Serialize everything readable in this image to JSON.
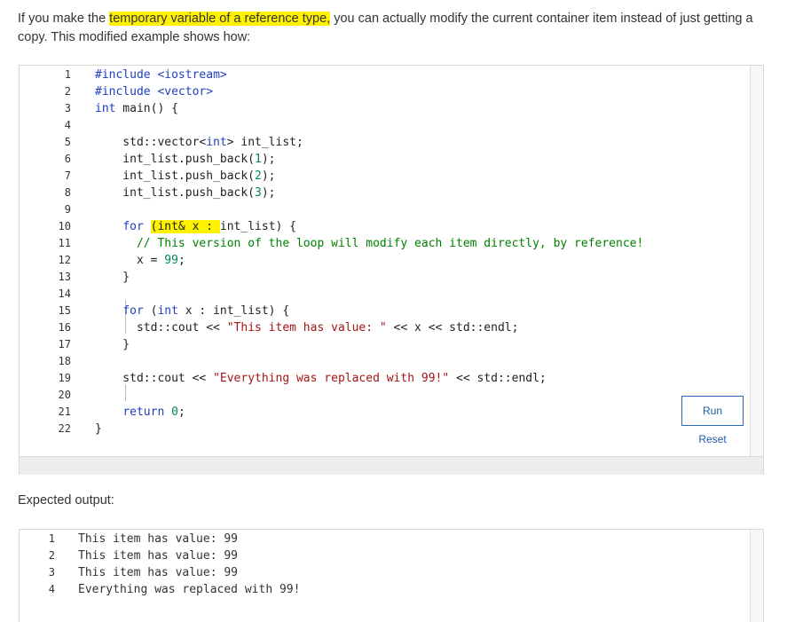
{
  "intro": {
    "before": "If you make the ",
    "highlight": "temporary variable of a reference type,",
    "after": " you can actually modify the current container item instead of just getting a copy. This modified example shows how:"
  },
  "code_lines": [
    {
      "n": "1",
      "parts": [
        [
          "pp",
          "#include "
        ],
        [
          "str2",
          "<iostream>"
        ]
      ]
    },
    {
      "n": "2",
      "parts": [
        [
          "pp",
          "#include "
        ],
        [
          "str2",
          "<vector>"
        ]
      ]
    },
    {
      "n": "3",
      "parts": [
        [
          "kw",
          "int"
        ],
        [
          "t",
          " main() {"
        ]
      ]
    },
    {
      "n": "4",
      "parts": []
    },
    {
      "n": "5",
      "parts": [
        [
          "t",
          "    std::vector<"
        ],
        [
          "kw",
          "int"
        ],
        [
          "t",
          "> int_list;"
        ]
      ]
    },
    {
      "n": "6",
      "parts": [
        [
          "t",
          "    int_list.push_back("
        ],
        [
          "num",
          "1"
        ],
        [
          "t",
          ");"
        ]
      ]
    },
    {
      "n": "7",
      "parts": [
        [
          "t",
          "    int_list.push_back("
        ],
        [
          "num",
          "2"
        ],
        [
          "t",
          ");"
        ]
      ]
    },
    {
      "n": "8",
      "parts": [
        [
          "t",
          "    int_list.push_back("
        ],
        [
          "num",
          "3"
        ],
        [
          "t",
          ");"
        ]
      ]
    },
    {
      "n": "9",
      "parts": []
    },
    {
      "n": "10",
      "parts": [
        [
          "t",
          "    "
        ],
        [
          "kw",
          "for"
        ],
        [
          "t",
          " "
        ],
        [
          "hl",
          "(int& x : "
        ],
        [
          "t",
          "int_list) {"
        ]
      ]
    },
    {
      "n": "11",
      "parts": [
        [
          "t",
          "      "
        ],
        [
          "cm",
          "// This version of the loop will modify each item directly, by reference!"
        ]
      ]
    },
    {
      "n": "12",
      "parts": [
        [
          "t",
          "      x = "
        ],
        [
          "num",
          "99"
        ],
        [
          "t",
          ";"
        ]
      ]
    },
    {
      "n": "13",
      "parts": [
        [
          "t",
          "    }"
        ]
      ]
    },
    {
      "n": "14",
      "parts": []
    },
    {
      "n": "15",
      "parts": [
        [
          "t",
          "    "
        ],
        [
          "kw",
          "for"
        ],
        [
          "t",
          " ("
        ],
        [
          "kw",
          "int"
        ],
        [
          "t",
          " x : int_list) {"
        ]
      ]
    },
    {
      "n": "16",
      "parts": [
        [
          "t",
          "      std::cout << "
        ],
        [
          "str",
          "\"This item has value: \""
        ],
        [
          "t",
          " << x << std::endl;"
        ]
      ]
    },
    {
      "n": "17",
      "parts": [
        [
          "t",
          "    }"
        ]
      ]
    },
    {
      "n": "18",
      "parts": []
    },
    {
      "n": "19",
      "parts": [
        [
          "t",
          "    std::cout << "
        ],
        [
          "str",
          "\"Everything was replaced with 99!\""
        ],
        [
          "t",
          " << std::endl;"
        ]
      ]
    },
    {
      "n": "20",
      "parts": []
    },
    {
      "n": "21",
      "parts": [
        [
          "t",
          "    "
        ],
        [
          "kw",
          "return"
        ],
        [
          "t",
          " "
        ],
        [
          "num",
          "0"
        ],
        [
          "t",
          ";"
        ]
      ]
    },
    {
      "n": "22",
      "parts": [
        [
          "t",
          "}"
        ]
      ]
    }
  ],
  "buttons": {
    "run": "Run",
    "reset": "Reset"
  },
  "expected_label": "Expected output:",
  "output_lines": [
    {
      "n": "1",
      "text": "This item has value: 99"
    },
    {
      "n": "2",
      "text": "This item has value: 99"
    },
    {
      "n": "3",
      "text": "This item has value: 99"
    },
    {
      "n": "4",
      "text": "Everything was replaced with 99!"
    }
  ],
  "colors": {
    "highlight": "#fff200",
    "keyword": "#1f3fbf",
    "string": "#a31515",
    "number": "#098658",
    "comment": "#008000",
    "button_border": "#2a66b2"
  }
}
